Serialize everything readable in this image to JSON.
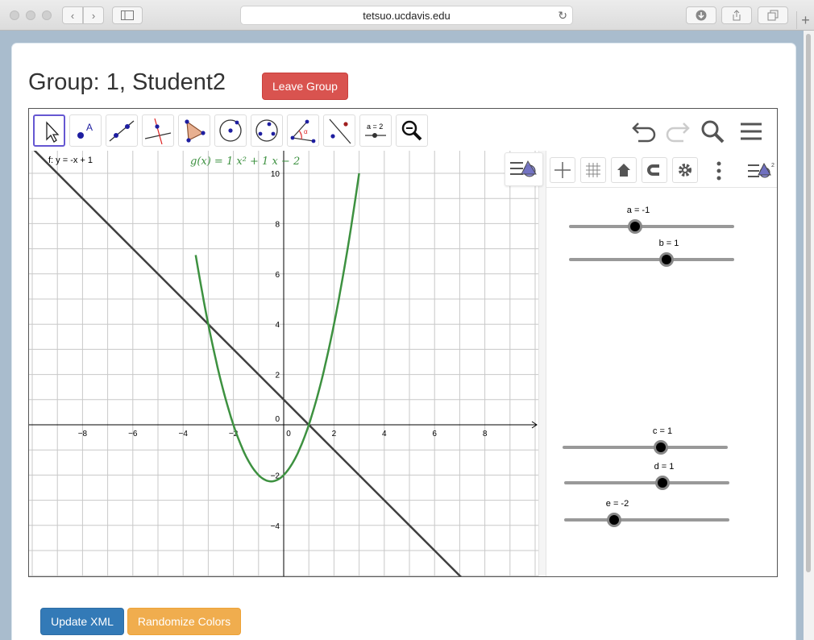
{
  "browser": {
    "url": "tetsuo.ucdavis.edu"
  },
  "page": {
    "title": "Group: 1, Student2",
    "leave_group_label": "Leave Group",
    "update_xml_label": "Update XML",
    "randomize_colors_label": "Randomize Colors"
  },
  "toolbar": {
    "tools": [
      {
        "name": "move-tool"
      },
      {
        "name": "point-tool",
        "glyph": "A"
      },
      {
        "name": "line-tool"
      },
      {
        "name": "perpendicular-line-tool"
      },
      {
        "name": "polygon-tool"
      },
      {
        "name": "circle-center-point-tool"
      },
      {
        "name": "circle-three-points-tool"
      },
      {
        "name": "angle-tool",
        "glyph": "α"
      },
      {
        "name": "reflect-about-line-tool"
      },
      {
        "name": "slider-tool",
        "glyph": "a = 2"
      },
      {
        "name": "zoom-out-tool"
      }
    ]
  },
  "graphics": {
    "f_label": "f: y = -x + 1",
    "g_label": "g(x)  =  1 x² + 1 x − 2",
    "colors": {
      "line": "#404040",
      "parabola": "#3d9140",
      "grid": "#c8c8c8",
      "axis": "#000000"
    },
    "x_ticks": [
      "−8",
      "−6",
      "−4",
      "−2",
      "0",
      "2",
      "4",
      "6",
      "8"
    ],
    "y_ticks": [
      "10",
      "8",
      "6",
      "4",
      "2",
      "−2",
      "−4"
    ]
  },
  "chart_data": {
    "type": "line",
    "series": [
      {
        "name": "f: y = -x + 1",
        "x": [
          -10,
          -8,
          -6,
          -4,
          -2,
          0,
          2,
          4,
          6,
          8
        ],
        "y": [
          11,
          9,
          7,
          5,
          3,
          1,
          -1,
          -3,
          -5,
          -7
        ]
      },
      {
        "name": "g(x) = 1x² + 1x − 2",
        "x": [
          -3.5,
          -3,
          -2.5,
          -2,
          -1.5,
          -1,
          -0.5,
          0,
          0.5,
          1,
          1.5,
          2,
          2.5,
          3
        ],
        "y": [
          6.75,
          4,
          1.75,
          0,
          -1.25,
          -2,
          -2.25,
          -2,
          -1.25,
          0,
          1.75,
          4,
          6.75,
          10
        ]
      }
    ],
    "xlim": [
      -10.2,
      10.2
    ],
    "ylim": [
      -6.1,
      10.9
    ],
    "grid": true
  },
  "sliders": [
    {
      "label": "a = -1",
      "value": -1
    },
    {
      "label": "b = 1",
      "value": 1
    },
    {
      "label": "c = 1",
      "value": 1
    },
    {
      "label": "d = 1",
      "value": 1
    },
    {
      "label": "e = -2",
      "value": -2
    }
  ]
}
